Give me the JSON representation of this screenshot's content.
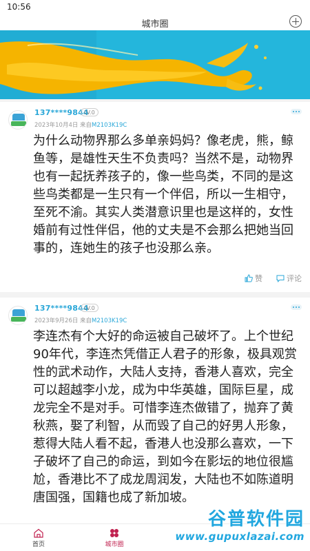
{
  "status": {
    "time": "10:56"
  },
  "header": {
    "title": "城市圈"
  },
  "posts": [
    {
      "username": "137****9844",
      "level": "LV.0",
      "date": "2023年10月4日",
      "from_label": "来自",
      "device": "M2103K19C",
      "content": "为什么动物界那么多单亲妈妈？像老虎，熊，鲸鱼等，是雄性天生不负责吗？当然不是，动物界也有一起抚养孩子的，像一些鸟类，不同的是这些鸟类都是一生只有一个伴侣，所以一生相守，至死不渝。其实人类潜意识里也是这样的，女性婚前有过性伴侣，他的丈夫是不会那么把她当回事的，连她生的孩子也没那么亲。",
      "like_label": "赞",
      "comment_label": "评论"
    },
    {
      "username": "137****9844",
      "level": "LV.0",
      "date": "2023年9月26日",
      "from_label": "来自",
      "device": "M2103K19C",
      "content": "李连杰有个大好的命运被自己破坏了。上个世纪90年代，李连杰凭借正人君子的形象，极具观赏性的武术动作，大陆人支持，香港人喜欢，完全可以超越李小龙，成为中华英雄，国际巨星，成龙完全不是对手。可惜李连杰做错了，抛弃了黄秋燕，娶了利智，从而毁了自己的好男人形象，惹得大陆人看不起，香港人也没那么喜欢，一下子破坏了自己的命运，到如今在影坛的地位很尴尬，香港比不了成龙周润发，大陆也不如陈道明唐国强，国籍也成了新加坡。"
    }
  ],
  "bottom_nav": [
    {
      "label": "首页",
      "icon": "home-icon"
    },
    {
      "label": "城市圈",
      "icon": "city-circle-icon",
      "active": true
    }
  ],
  "watermark": {
    "line1": "谷普软件园",
    "line2": "www.gupuxlazai.com"
  },
  "colors": {
    "accent": "#2aa7d8",
    "nav_active": "#c0214f",
    "banner_blue": "#22b4da",
    "banner_yellow": "#f5b400"
  }
}
